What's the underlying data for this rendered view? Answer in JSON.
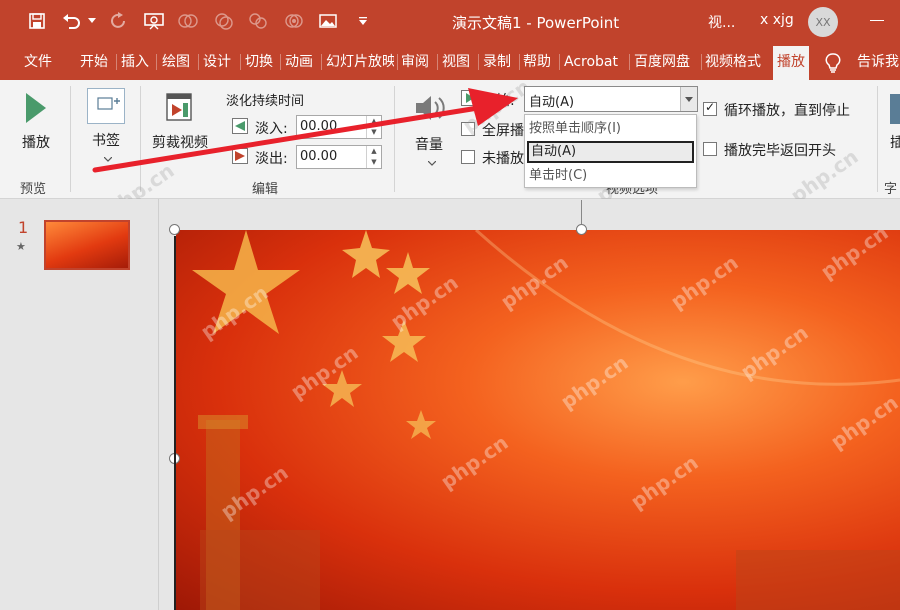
{
  "titlebar": {
    "document_title": "演示文稿1  -  PowerPoint",
    "video_label": "视...",
    "user_name": "x xjg",
    "avatar_initials": "XX"
  },
  "tabs": [
    "文件",
    "开始",
    "插入",
    "绘图",
    "设计",
    "切换",
    "动画",
    "幻灯片放映",
    "审阅",
    "视图",
    "录制",
    "帮助",
    "Acrobat",
    "百度网盘",
    "视频格式",
    "播放",
    "告诉我"
  ],
  "active_tab": "播放",
  "ribbon": {
    "preview": {
      "play_label": "播放",
      "group_label": "预览"
    },
    "bookmark": {
      "label": "书签"
    },
    "editing": {
      "trim_label": "剪裁视频",
      "fade_heading": "淡化持续时间",
      "fade_in_label": "淡入:",
      "fade_in_value": "00.00",
      "fade_out_label": "淡出:",
      "fade_out_value": "00.00",
      "group_label": "编辑"
    },
    "volume": {
      "label": "音量"
    },
    "video_options": {
      "start_label": "开始:",
      "start_value": "自动(A)",
      "fullscreen_label": "全屏播",
      "hide_label": "未播放",
      "loop_label": "循环播放，直到停止",
      "loop_checked": true,
      "rewind_label": "播放完毕返回开头",
      "rewind_checked": false,
      "group_label": "视频选项"
    },
    "caption_partial_1": "插",
    "caption_partial_2": "字幕"
  },
  "start_dropdown": {
    "options": [
      "按照单击顺序(I)",
      "自动(A)",
      "单击时(C)"
    ],
    "selected": "自动(A)"
  },
  "slides_pane": {
    "slide_number": "1",
    "transition_marker": "★"
  },
  "watermark_text": "php.cn",
  "colors": {
    "accent": "#c1432c",
    "ribbon_bg": "#f3f3f3",
    "arrow": "#e8212b",
    "play_green": "#4a9a6b"
  }
}
